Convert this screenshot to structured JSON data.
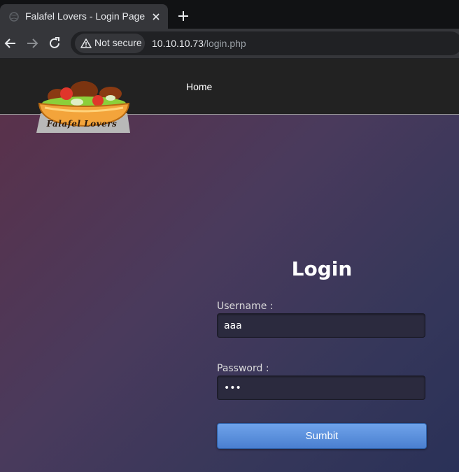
{
  "browser": {
    "tab": {
      "title": "Falafel Lovers - Login Page"
    },
    "security_label": "Not secure",
    "url_host": "10.10.10.73",
    "url_path": "/login.php"
  },
  "navbar": {
    "home_label": "Home",
    "logo_text": "Falafel Lovers"
  },
  "login": {
    "title": "Login",
    "username_label": "Username :",
    "username_value": "aaa",
    "password_label": "Password :",
    "password_value": "aaa",
    "submit_label": "Sumbit"
  },
  "colors": {
    "accent_button": "#5a8fdf",
    "navbar_bg": "#222222"
  }
}
